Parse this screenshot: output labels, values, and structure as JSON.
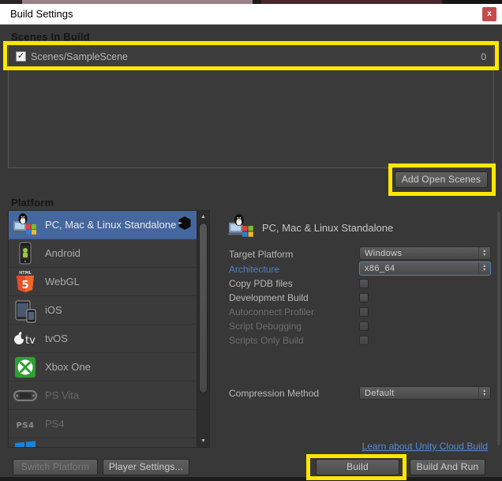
{
  "titlebar": {
    "title": "Build Settings",
    "close": "x"
  },
  "scenes": {
    "header": "Scenes In Build",
    "rows": [
      {
        "name": "Scenes/SampleScene",
        "checked": true,
        "checkmark": "✓",
        "index": "0"
      }
    ],
    "add_open_scenes": "Add Open Scenes"
  },
  "platform": {
    "header": "Platform",
    "items": [
      {
        "label": "PC, Mac & Linux Standalone",
        "selected": true,
        "disabled": false
      },
      {
        "label": "Android",
        "selected": false,
        "disabled": false
      },
      {
        "label": "WebGL",
        "selected": false,
        "disabled": false
      },
      {
        "label": "iOS",
        "selected": false,
        "disabled": false
      },
      {
        "label": "tvOS",
        "selected": false,
        "disabled": false
      },
      {
        "label": "Xbox One",
        "selected": false,
        "disabled": false
      },
      {
        "label": "PS Vita",
        "selected": false,
        "disabled": true
      },
      {
        "label": "PS4",
        "selected": false,
        "disabled": true
      }
    ]
  },
  "details": {
    "title": "PC, Mac & Linux Standalone",
    "target_platform": {
      "label": "Target Platform",
      "value": "Windows"
    },
    "architecture": {
      "label": "Architecture",
      "value": "x86_64",
      "focused": true
    },
    "copy_pdb": {
      "label": "Copy PDB files",
      "checked": false
    },
    "development_build": {
      "label": "Development Build",
      "checked": false
    },
    "autoconnect_profiler": {
      "label": "Autoconnect Profiler",
      "checked": false,
      "disabled": true
    },
    "script_debugging": {
      "label": "Script Debugging",
      "checked": false,
      "disabled": true
    },
    "scripts_only_build": {
      "label": "Scripts Only Build",
      "checked": false,
      "disabled": true
    },
    "compression_method": {
      "label": "Compression Method",
      "value": "Default"
    },
    "link": "Learn about Unity Cloud Build"
  },
  "footer": {
    "switch_platform": "Switch Platform",
    "player_settings": "Player Settings...",
    "build": "Build",
    "build_and_run": "Build And Run"
  },
  "colors": {
    "highlight_yellow": "#ffe600",
    "selection_blue": "#45679f",
    "link_blue": "#5b8ad2",
    "architecture_label_blue": "#4e81c4",
    "close_red": "#c24c4c",
    "body_bg": "#383838"
  }
}
